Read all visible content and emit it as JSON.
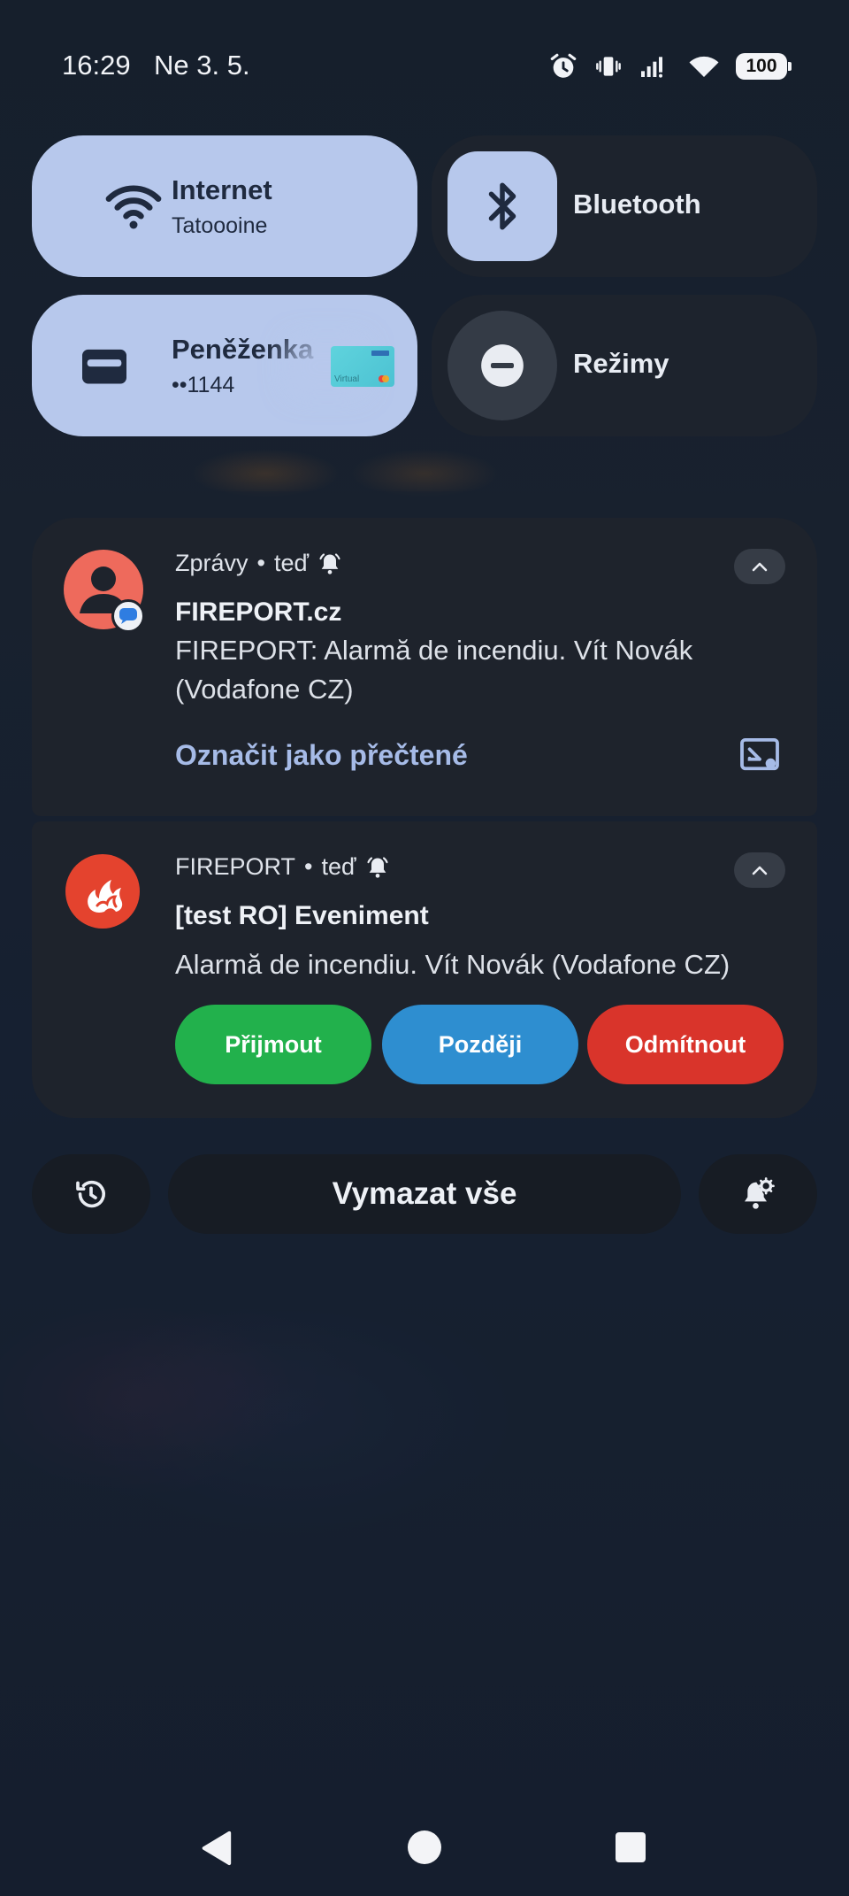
{
  "status_bar": {
    "time": "16:29",
    "date": "Ne 3. 5.",
    "battery": "100"
  },
  "tiles": {
    "internet": {
      "title": "Internet",
      "subtitle": "Tatoooine"
    },
    "bluetooth": {
      "title": "Bluetooth"
    },
    "wallet": {
      "title": "Peněženka",
      "subtitle": "••1144",
      "card_text": "Virtual"
    },
    "modes": {
      "title": "Režimy"
    }
  },
  "notifications": [
    {
      "app": "Zprávy",
      "time": "teď",
      "title": "FIREPORT.cz",
      "text": "FIREPORT: Alarmă de incendiu. Vít Novák (Vodafone CZ)",
      "action": "Označit jako přečtené"
    },
    {
      "app": "FIREPORT",
      "time": "teď",
      "title": "[test RO] Eveniment",
      "text": "Alarmă de incendiu. Vít Novák (Vodafone CZ)",
      "buttons": [
        "Přijmout",
        "Později",
        "Odmítnout"
      ]
    }
  ],
  "bottom": {
    "clear_all": "Vymazat vše"
  },
  "colors": {
    "tile_active": "#b7c8ec",
    "accept": "#22b14c",
    "later": "#2e8ed0",
    "decline": "#d9342b",
    "link": "#a6bbe7"
  }
}
